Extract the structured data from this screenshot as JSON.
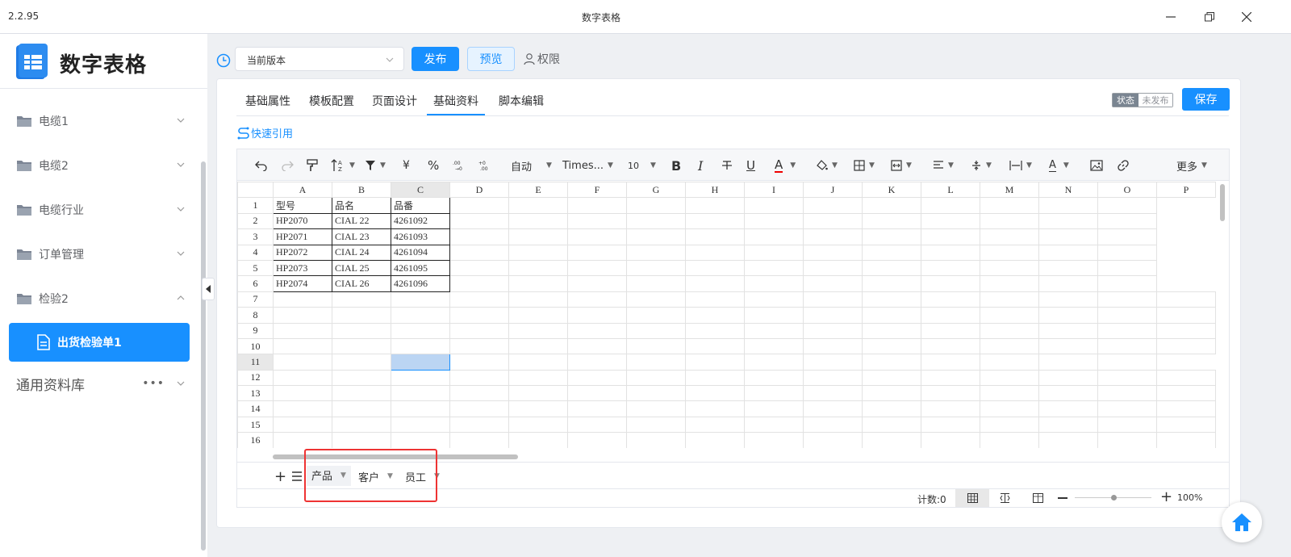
{
  "window": {
    "version": "2.2.95",
    "title": "数字表格"
  },
  "sidebar": {
    "app_name": "数字表格",
    "items": [
      {
        "label": "电缆1"
      },
      {
        "label": "电缆2"
      },
      {
        "label": "电缆行业"
      },
      {
        "label": "订单管理"
      },
      {
        "label": "检验2"
      }
    ],
    "active_item": "出货检验单1",
    "library": "通用资料库",
    "library_more": "•••"
  },
  "topbar": {
    "version_select": "当前版本",
    "publish": "发布",
    "preview": "预览",
    "permission": "权限"
  },
  "tabs": [
    {
      "label": "基础属性"
    },
    {
      "label": "模板配置"
    },
    {
      "label": "页面设计"
    },
    {
      "label": "基础资料",
      "active": true
    },
    {
      "label": "脚本编辑"
    }
  ],
  "status": {
    "label": "状态",
    "value": "未发布"
  },
  "save": "保存",
  "quick_ref": "快速引用",
  "toolbar": {
    "number_format": "自动",
    "font": "Times...",
    "font_size": "10",
    "more": "更多",
    "currency": "¥",
    "percent": "%",
    "bold": "B",
    "italic": "I",
    "underline": "U",
    "font_color": "A",
    "text_color": "A"
  },
  "grid": {
    "columns": [
      "A",
      "B",
      "C",
      "D",
      "E",
      "F",
      "G",
      "H",
      "I",
      "J",
      "K",
      "L",
      "M",
      "N",
      "O",
      "P"
    ],
    "rows": [
      [
        "型号",
        "品名",
        "品番"
      ],
      [
        "HP2070",
        "CIAL 22",
        "4261092"
      ],
      [
        "HP2071",
        "CIAL 23",
        "4261093"
      ],
      [
        "HP2072",
        "CIAL 24",
        "4261094"
      ],
      [
        "HP2073",
        "CIAL 25",
        "4261095"
      ],
      [
        "HP2074",
        "CIAL 26",
        "4261096"
      ]
    ],
    "row_numbers": [
      "1",
      "2",
      "3",
      "4",
      "5",
      "6",
      "7",
      "8",
      "9",
      "10",
      "11",
      "12",
      "13",
      "14",
      "15",
      "16"
    ],
    "selected_cell": "C11"
  },
  "sheet_tabs": [
    {
      "label": "产品"
    },
    {
      "label": "客户"
    },
    {
      "label": "员工"
    }
  ],
  "statusbar": {
    "count": "计数:0",
    "zoom": "100%"
  },
  "colors": {
    "accent": "#1890ff",
    "highlight_box": "#ee3333"
  }
}
